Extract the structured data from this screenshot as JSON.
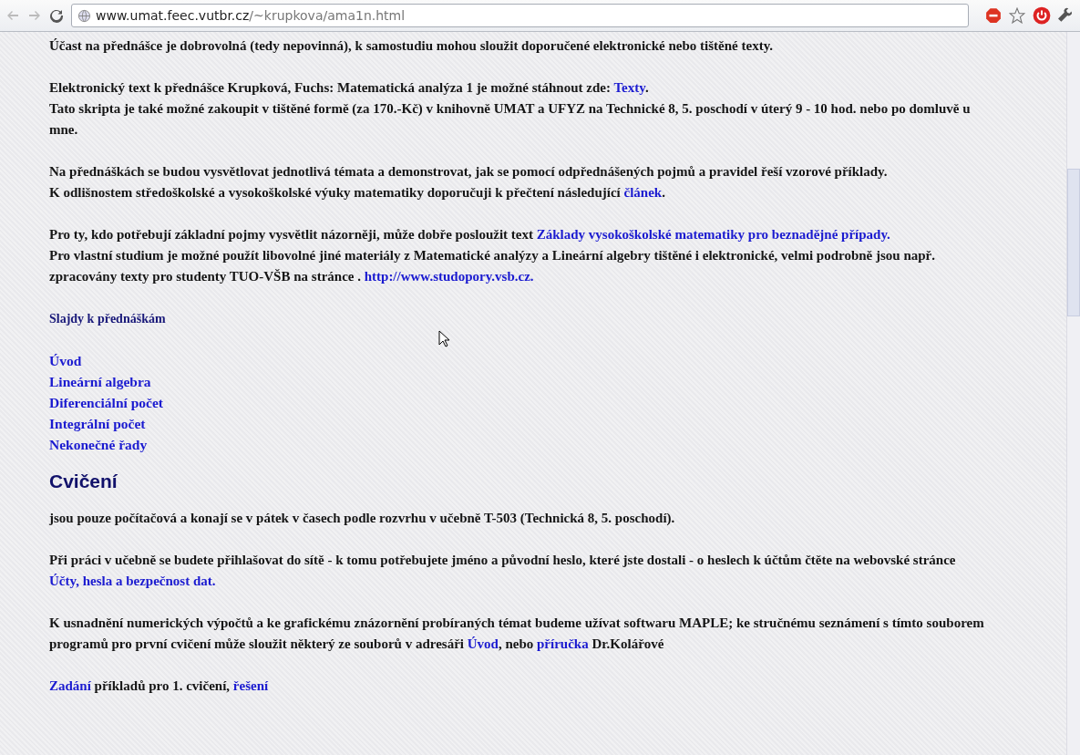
{
  "browser": {
    "url_host": "www.umat.feec.vutbr.cz",
    "url_path": "/~krupkova/ama1n.html"
  },
  "content": [
    {
      "kind": "paragraph",
      "lines": [
        [
          {
            "text": "Účast na přednášce je dobrovolná (tedy nepovinná), k samostudiu mohou sloužit doporučené elektronické nebo tištěné texty."
          }
        ]
      ]
    },
    {
      "kind": "paragraph",
      "lines": [
        [
          {
            "text": "Elektronický text k přednášce   Krupková, Fuchs: Matematická analýza 1  je možné stáhnout zde: "
          },
          {
            "text": "Texty",
            "link": true
          },
          {
            "text": "."
          }
        ],
        [
          {
            "text": "Tato skripta je také možné zakoupit v tištěné formě (za 170.-Kč) v knihovně UMAT a UFYZ na Technické 8, 5. poschodí v úterý 9 - 10 hod. nebo po domluvě u mne."
          }
        ]
      ]
    },
    {
      "kind": "paragraph",
      "lines": [
        [
          {
            "text": "Na přednáškách se budou vysvětlovat jednotlivá témata a demonstrovat, jak se pomocí odpřednášených pojmů a pravidel řeší vzorové příklady."
          }
        ],
        [
          {
            "text": "K odlišnostem středoškolské a vysokoškolské výuky matematiky doporučuji k přečtení následující "
          },
          {
            "text": "článek",
            "link": true
          },
          {
            "text": "."
          }
        ]
      ]
    },
    {
      "kind": "paragraph",
      "lines": [
        [
          {
            "text": "Pro ty, kdo potřebují základní pojmy vysvětlit názorněji, může dobře posloužit text "
          },
          {
            "text": "Základy vysokoškolské matematiky pro beznadějné případy.",
            "link": true
          }
        ],
        [
          {
            "text": "Pro vlastní studium je možné použít libovolné jiné materiály z Matematické analýzy a Lineární algebry tištěné i elektronické, velmi podrobně jsou např. zpracovány texty pro studenty TUO-VŠB na stránce . "
          },
          {
            "text": "http://www.studopory.vsb.cz.",
            "link": true
          }
        ]
      ]
    },
    {
      "kind": "subheading",
      "text": "Slajdy k přednáškám"
    },
    {
      "kind": "link_list",
      "items": [
        "Úvod",
        "Lineární algebra",
        "Diferenciální počet",
        "Integrální počet",
        "Nekonečné řady"
      ]
    },
    {
      "kind": "heading",
      "text": "Cvičení"
    },
    {
      "kind": "paragraph",
      "lines": [
        [
          {
            "text": "jsou pouze počítačová a konají se v pátek v časech podle rozvrhu v učebně T-503 (Technická 8, 5. poschodí)."
          }
        ]
      ]
    },
    {
      "kind": "paragraph",
      "lines": [
        [
          {
            "text": "Při práci v učebně se budete přihlašovat do sítě - k tomu potřebujete jméno a původní heslo, které jste dostali - o heslech k účtům čtěte na webovské stránce "
          },
          {
            "text": "Účty, hesla a bezpečnost dat.",
            "link": true
          }
        ]
      ]
    },
    {
      "kind": "paragraph",
      "lines": [
        [
          {
            "text": "K usnadnění numerických výpočtů a ke grafickému znázornění probíraných témat budeme užívat softwaru MAPLE; ke stručnému seznámení s tímto souborem programů pro první cvičení může sloužit některý ze souborů v adresáři "
          },
          {
            "text": "Úvod",
            "link": true
          },
          {
            "text": ", nebo "
          },
          {
            "text": "příručka",
            "link": true
          },
          {
            "text": " Dr.Kolářové"
          }
        ]
      ]
    },
    {
      "kind": "paragraph",
      "lines": [
        [
          {
            "text": "Zadání",
            "link": true
          },
          {
            "text": " příkladů pro 1. cvičení, "
          },
          {
            "text": "řešení",
            "link": true
          }
        ]
      ]
    }
  ]
}
